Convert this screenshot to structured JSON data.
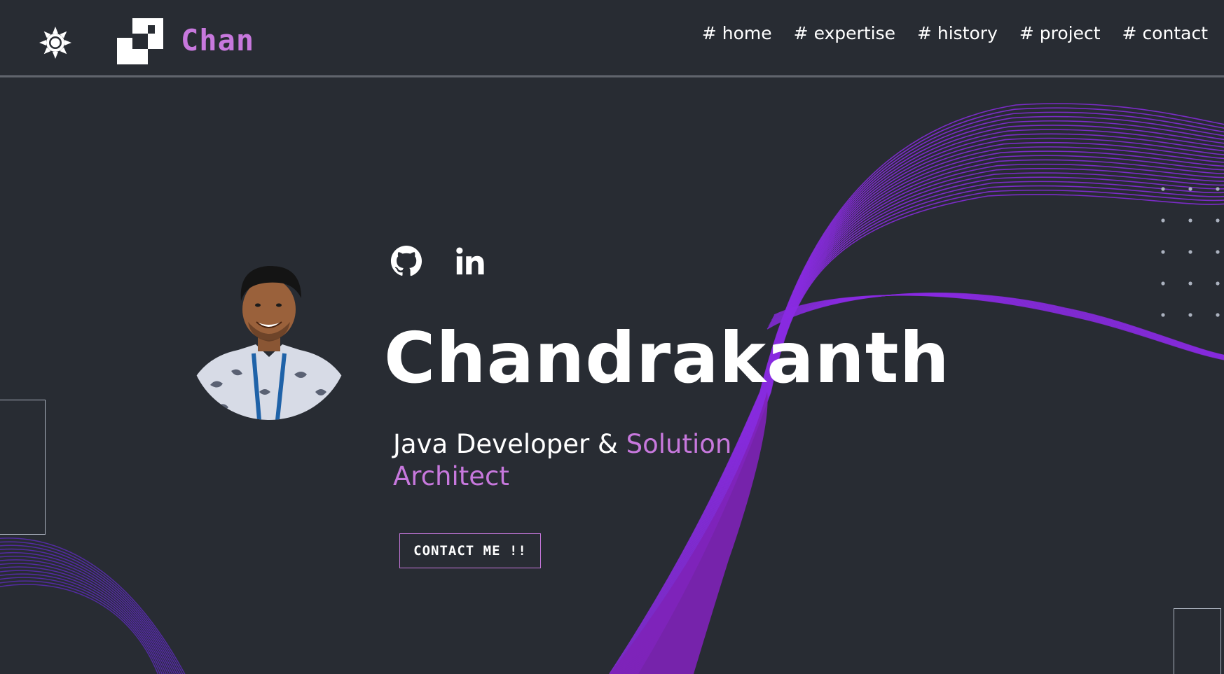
{
  "header": {
    "theme_toggle_icon": "sun-icon",
    "logo_icon": "pixel-logo-icon",
    "logo_text": "Chan",
    "nav": [
      {
        "label": "# home"
      },
      {
        "label": "# expertise"
      },
      {
        "label": "# history"
      },
      {
        "label": "# project"
      },
      {
        "label": "# contact"
      }
    ]
  },
  "hero": {
    "avatar_icon": "profile-photo",
    "social": [
      {
        "icon": "github-icon"
      },
      {
        "icon": "linkedin-icon"
      }
    ],
    "name": "Chandrakanth",
    "role_prefix": "Java Developer & ",
    "role_accent": "Solution Architect",
    "cta_label": "CONTACT ME !!"
  },
  "colors": {
    "background": "#282c33",
    "accent": "#c778dd",
    "wave": "#8a2be2",
    "text": "#ffffff",
    "frame": "#abb2bf"
  }
}
